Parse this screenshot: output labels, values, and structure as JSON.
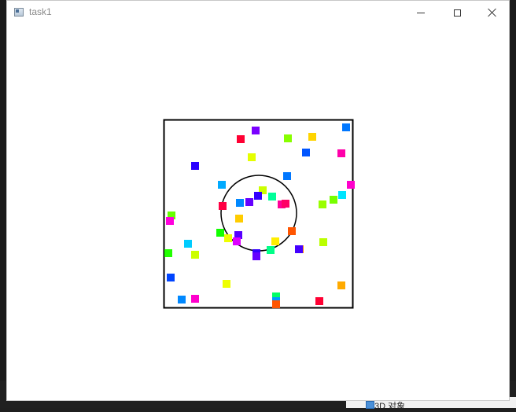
{
  "window": {
    "title": "task1",
    "controls": {
      "minimize_icon": "minimize-icon",
      "maximize_icon": "maximize-icon",
      "close_icon": "close-icon"
    }
  },
  "taskbar_peek": {
    "label": "3D 对象"
  },
  "scene": {
    "boundary_color": "#000000",
    "circle_color": "#000000",
    "particle_colors": [
      "#ff0000",
      "#00ff00",
      "#0000ff",
      "#ffff00",
      "#ff00ff",
      "#00ffff",
      "#7fff00",
      "#ff7f00",
      "#7f00ff",
      "#00ff7f"
    ]
  }
}
